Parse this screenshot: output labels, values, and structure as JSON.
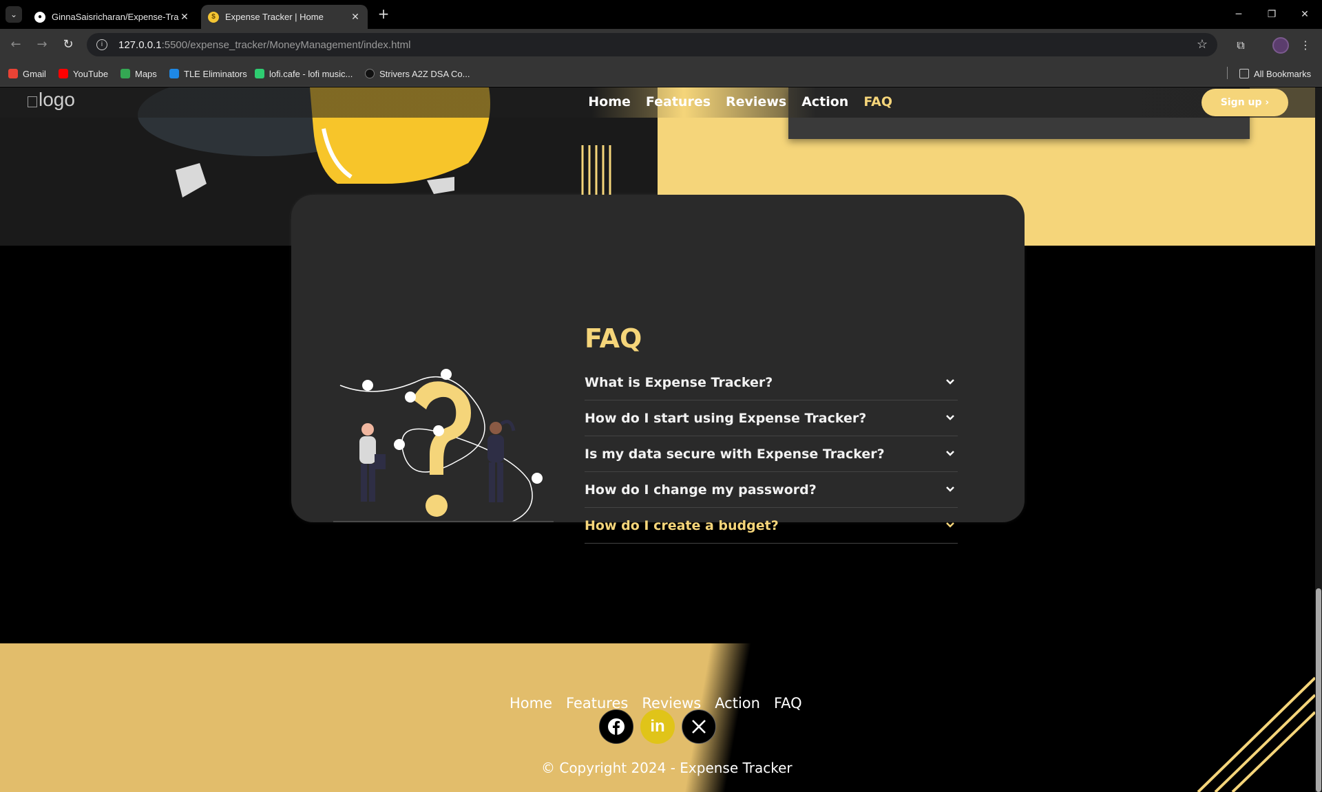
{
  "browser": {
    "tabs": [
      {
        "title": "GinnaSaisricharan/Expense-Trac",
        "favicon": "github-icon",
        "active": false
      },
      {
        "title": "Expense Tracker | Home",
        "favicon": "expense-tracker-icon",
        "active": true
      }
    ],
    "new_tab": "+",
    "url_host": "127.0.0.1",
    "url_path": ":5500/expense_tracker/MoneyManagement/index.html",
    "bookmarks": [
      {
        "label": "Gmail",
        "icon": "gmail-icon",
        "color": "#ea4335"
      },
      {
        "label": "YouTube",
        "icon": "youtube-icon",
        "color": "#ff0000"
      },
      {
        "label": "Maps",
        "icon": "maps-icon",
        "color": "#34a853"
      },
      {
        "label": "TLE Eliminators",
        "icon": "tle-icon",
        "color": "#1e88e5"
      },
      {
        "label": "lofi.cafe - lofi music...",
        "icon": "lofi-icon",
        "color": "#2ecc71"
      },
      {
        "label": "Strivers A2Z DSA Co...",
        "icon": "tuf-icon",
        "color": "#111111"
      }
    ],
    "all_bookmarks": "All Bookmarks"
  },
  "navbar": {
    "logo_alt": "logo",
    "links": [
      "Home",
      "Features",
      "Reviews",
      "Action",
      "FAQ"
    ],
    "signup": "Sign up ›"
  },
  "faq": {
    "title": "FAQ",
    "questions": [
      "What is Expense Tracker?",
      "How do I start using Expense Tracker?",
      "Is my data secure with Expense Tracker?",
      "How do I change my password?",
      "How do I create a budget?"
    ],
    "active_index": 4
  },
  "footer": {
    "links": [
      "Home",
      "Features",
      "Reviews",
      "Action",
      "FAQ"
    ],
    "social": [
      {
        "name": "facebook-icon",
        "bg": "#000000"
      },
      {
        "name": "linkedin-icon",
        "bg": "#e0c419"
      },
      {
        "name": "x-icon",
        "bg": "#000000"
      }
    ],
    "copyright": "© Copyright 2024 - Expense Tracker"
  },
  "colors": {
    "accent": "#f5d57a",
    "card": "#2a2a2a",
    "footer": "#e2bd6b"
  }
}
